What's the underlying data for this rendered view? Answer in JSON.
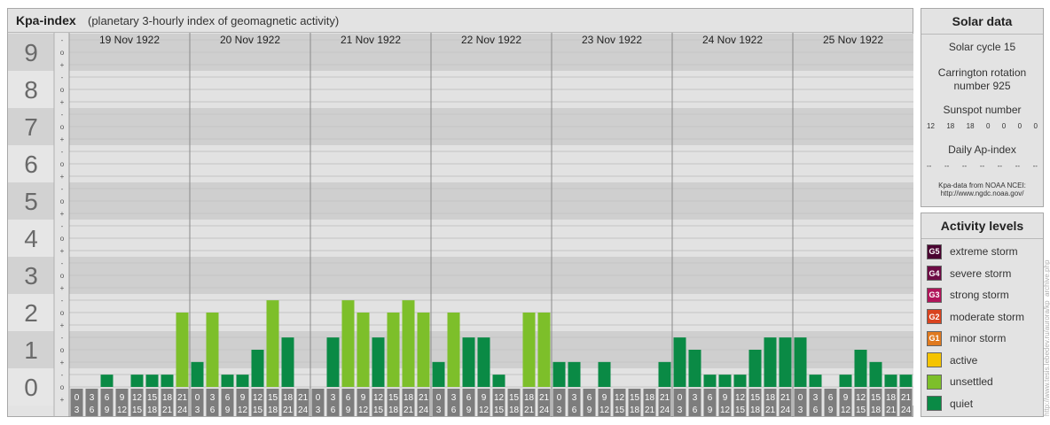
{
  "header": {
    "title": "Kpa-index",
    "subtitle": "(planetary 3-hourly index of geomagnetic activity)"
  },
  "chart_data": {
    "type": "bar",
    "title": "Kpa-index",
    "subtitle": "(planetary 3-hourly index of geomagnetic activity)",
    "ylim": [
      0,
      9.6
    ],
    "y_ticks": [
      "0",
      "1",
      "2",
      "3",
      "4",
      "5",
      "6",
      "7",
      "8",
      "9"
    ],
    "sub_ticks": [
      "-",
      "o",
      "+"
    ],
    "days": [
      "19 Nov 1922",
      "20 Nov 1922",
      "21 Nov 1922",
      "22 Nov 1922",
      "23 Nov 1922",
      "24 Nov 1922",
      "25 Nov 1922"
    ],
    "interval_start_labels": [
      "0",
      "3",
      "6",
      "9",
      "12",
      "15",
      "18",
      "21"
    ],
    "interval_end_labels": [
      "3",
      "6",
      "9",
      "12",
      "15",
      "18",
      "21",
      "24"
    ],
    "values": [
      0,
      0,
      0.33,
      0,
      0.33,
      0.33,
      0.33,
      2,
      0.67,
      2,
      0.33,
      0.33,
      1,
      2.33,
      1.33,
      0,
      0,
      1.33,
      2.33,
      2,
      1.33,
      2,
      2.33,
      2,
      0.67,
      2,
      1.33,
      1.33,
      0.33,
      0,
      2,
      2,
      0.67,
      0.67,
      0,
      0.67,
      0,
      0,
      0,
      0.67,
      1.33,
      1,
      0.33,
      0.33,
      0.33,
      1,
      1.33,
      1.33,
      1.33,
      0.33,
      0,
      0.33,
      1,
      0.67,
      0.33,
      0.33
    ],
    "legend": [
      "extreme storm",
      "severe storm",
      "strong storm",
      "moderate storm",
      "minor storm",
      "active",
      "unsettled",
      "quiet"
    ]
  },
  "colors": {
    "quiet": "#0a8a45",
    "unsettled": "#7dbf2a",
    "active": "#f5c400",
    "minor_storm": "#e07a1f",
    "moderate_storm": "#d9431f",
    "strong_storm": "#b0155a",
    "severe_storm": "#6d0c45",
    "extreme_storm": "#4a0431"
  },
  "solar_data": {
    "title": "Solar data",
    "solar_cycle": "Solar cycle 15",
    "carrington_line1": "Carrington rotation",
    "carrington_line2": "number 925",
    "sunspot_title": "Sunspot number",
    "sunspot_values": [
      "12",
      "18",
      "18",
      "0",
      "0",
      "0",
      "0"
    ],
    "ap_title": "Daily Ap-index",
    "ap_values": [
      "--",
      "--",
      "--",
      "--",
      "--",
      "--",
      "--"
    ],
    "source_line1": "Kpa-data from NOAA NCEI:",
    "source_line2": "http://www.ngdc.noaa.gov/"
  },
  "activity_levels": {
    "title": "Activity levels",
    "items": [
      {
        "badge": "G5",
        "label": "extreme storm",
        "color": "#4a0431"
      },
      {
        "badge": "G4",
        "label": "severe storm",
        "color": "#6d0c45"
      },
      {
        "badge": "G3",
        "label": "strong storm",
        "color": "#b0155a"
      },
      {
        "badge": "G2",
        "label": "moderate storm",
        "color": "#d9431f"
      },
      {
        "badge": "G1",
        "label": "minor storm",
        "color": "#e07a1f"
      },
      {
        "badge": "",
        "label": "active",
        "color": "#f5c400"
      },
      {
        "badge": "",
        "label": "unsettled",
        "color": "#7dbf2a"
      },
      {
        "badge": "",
        "label": "quiet",
        "color": "#0a8a45"
      }
    ]
  },
  "credit": "http://www.tesis.lebedev.ru/aurora/kp_archive.php"
}
